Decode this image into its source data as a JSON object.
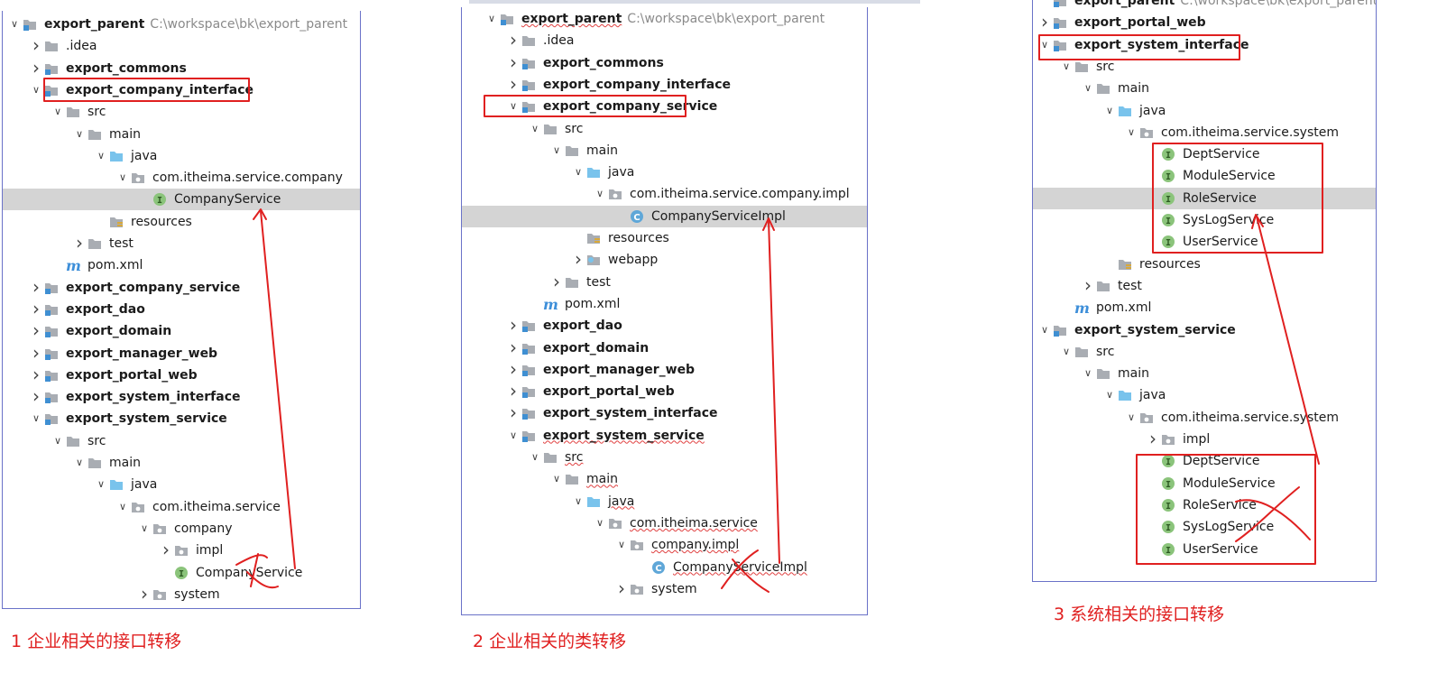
{
  "panels": [
    {
      "id": "p1",
      "rows": [
        {
          "d": 0,
          "arrow": "down",
          "icon": "module-folder",
          "text": "export_parent",
          "bold": true,
          "extra": "C:\\workspace\\bk\\export_parent"
        },
        {
          "d": 1,
          "arrow": "right",
          "icon": "folder",
          "text": ".idea"
        },
        {
          "d": 1,
          "arrow": "right",
          "icon": "module-folder",
          "text": "export_commons",
          "bold": true
        },
        {
          "d": 1,
          "arrow": "down",
          "icon": "module-folder",
          "text": "export_company_interface",
          "bold": true
        },
        {
          "d": 2,
          "arrow": "down",
          "icon": "folder",
          "text": "src"
        },
        {
          "d": 3,
          "arrow": "down",
          "icon": "folder",
          "text": "main"
        },
        {
          "d": 4,
          "arrow": "down",
          "icon": "source-folder",
          "text": "java"
        },
        {
          "d": 5,
          "arrow": "down",
          "icon": "package",
          "text": "com.itheima.service.company"
        },
        {
          "d": 6,
          "arrow": "none",
          "icon": "interface",
          "text": "CompanyService",
          "selected": true
        },
        {
          "d": 4,
          "arrow": "none",
          "icon": "resources-folder",
          "text": "resources"
        },
        {
          "d": 3,
          "arrow": "right",
          "icon": "folder",
          "text": "test"
        },
        {
          "d": 2,
          "arrow": "none",
          "icon": "maven",
          "text": "pom.xml"
        },
        {
          "d": 1,
          "arrow": "right",
          "icon": "module-folder",
          "text": "export_company_service",
          "bold": true
        },
        {
          "d": 1,
          "arrow": "right",
          "icon": "module-folder",
          "text": "export_dao",
          "bold": true
        },
        {
          "d": 1,
          "arrow": "right",
          "icon": "module-folder",
          "text": "export_domain",
          "bold": true
        },
        {
          "d": 1,
          "arrow": "right",
          "icon": "module-folder",
          "text": "export_manager_web",
          "bold": true
        },
        {
          "d": 1,
          "arrow": "right",
          "icon": "module-folder",
          "text": "export_portal_web",
          "bold": true
        },
        {
          "d": 1,
          "arrow": "right",
          "icon": "module-folder",
          "text": "export_system_interface",
          "bold": true
        },
        {
          "d": 1,
          "arrow": "down",
          "icon": "module-folder",
          "text": "export_system_service",
          "bold": true
        },
        {
          "d": 2,
          "arrow": "down",
          "icon": "folder",
          "text": "src"
        },
        {
          "d": 3,
          "arrow": "down",
          "icon": "folder",
          "text": "main"
        },
        {
          "d": 4,
          "arrow": "down",
          "icon": "source-folder",
          "text": "java"
        },
        {
          "d": 5,
          "arrow": "down",
          "icon": "package",
          "text": "com.itheima.service"
        },
        {
          "d": 6,
          "arrow": "down",
          "icon": "package",
          "text": "company"
        },
        {
          "d": 7,
          "arrow": "right",
          "icon": "package",
          "text": "impl"
        },
        {
          "d": 7,
          "arrow": "none",
          "icon": "interface",
          "text": "CompanyService"
        },
        {
          "d": 6,
          "arrow": "right",
          "icon": "package",
          "text": "system"
        }
      ]
    },
    {
      "id": "p2",
      "rows": [
        {
          "d": 0,
          "arrow": "down",
          "icon": "module-folder",
          "text": "export_parent",
          "bold": true,
          "squig": true,
          "extra": "C:\\workspace\\bk\\export_parent"
        },
        {
          "d": 1,
          "arrow": "right",
          "icon": "folder",
          "text": ".idea"
        },
        {
          "d": 1,
          "arrow": "right",
          "icon": "module-folder",
          "text": "export_commons",
          "bold": true
        },
        {
          "d": 1,
          "arrow": "right",
          "icon": "module-folder",
          "text": "export_company_interface",
          "bold": true
        },
        {
          "d": 1,
          "arrow": "down",
          "icon": "module-folder",
          "text": "export_company_service",
          "bold": true
        },
        {
          "d": 2,
          "arrow": "down",
          "icon": "folder",
          "text": "src"
        },
        {
          "d": 3,
          "arrow": "down",
          "icon": "folder",
          "text": "main"
        },
        {
          "d": 4,
          "arrow": "down",
          "icon": "source-folder",
          "text": "java"
        },
        {
          "d": 5,
          "arrow": "down",
          "icon": "package",
          "text": "com.itheima.service.company.impl"
        },
        {
          "d": 6,
          "arrow": "none",
          "icon": "class",
          "text": "CompanyServiceImpl",
          "selected": true
        },
        {
          "d": 4,
          "arrow": "none",
          "icon": "resources-folder",
          "text": "resources"
        },
        {
          "d": 4,
          "arrow": "right",
          "icon": "web-folder",
          "text": "webapp"
        },
        {
          "d": 3,
          "arrow": "right",
          "icon": "folder",
          "text": "test"
        },
        {
          "d": 2,
          "arrow": "none",
          "icon": "maven",
          "text": "pom.xml"
        },
        {
          "d": 1,
          "arrow": "right",
          "icon": "module-folder",
          "text": "export_dao",
          "bold": true
        },
        {
          "d": 1,
          "arrow": "right",
          "icon": "module-folder",
          "text": "export_domain",
          "bold": true
        },
        {
          "d": 1,
          "arrow": "right",
          "icon": "module-folder",
          "text": "export_manager_web",
          "bold": true
        },
        {
          "d": 1,
          "arrow": "right",
          "icon": "module-folder",
          "text": "export_portal_web",
          "bold": true
        },
        {
          "d": 1,
          "arrow": "right",
          "icon": "module-folder",
          "text": "export_system_interface",
          "bold": true
        },
        {
          "d": 1,
          "arrow": "down",
          "icon": "module-folder",
          "text": "export_system_service",
          "bold": true,
          "squig": true
        },
        {
          "d": 2,
          "arrow": "down",
          "icon": "folder",
          "text": "src",
          "squig": true
        },
        {
          "d": 3,
          "arrow": "down",
          "icon": "folder",
          "text": "main",
          "squig": true
        },
        {
          "d": 4,
          "arrow": "down",
          "icon": "source-folder",
          "text": "java",
          "squig": true
        },
        {
          "d": 5,
          "arrow": "down",
          "icon": "package",
          "text": "com.itheima.service",
          "squig": true
        },
        {
          "d": 6,
          "arrow": "down",
          "icon": "package",
          "text": "company.impl",
          "squig": true
        },
        {
          "d": 7,
          "arrow": "none",
          "icon": "class",
          "text": "CompanyServiceImpl",
          "squig": true
        },
        {
          "d": 6,
          "arrow": "right",
          "icon": "package",
          "text": "system"
        }
      ]
    },
    {
      "id": "p3",
      "rows": [
        {
          "d": 0,
          "arrow": "none",
          "icon": "module-folder",
          "text": "export_parent",
          "bold": true,
          "extra": "C:\\workspace\\bk\\export_parent"
        },
        {
          "d": 0,
          "arrow": "right",
          "icon": "module-folder",
          "text": "export_portal_web",
          "bold": true
        },
        {
          "d": 0,
          "arrow": "down",
          "icon": "module-folder",
          "text": "export_system_interface",
          "bold": true
        },
        {
          "d": 1,
          "arrow": "down",
          "icon": "folder",
          "text": "src"
        },
        {
          "d": 2,
          "arrow": "down",
          "icon": "folder",
          "text": "main"
        },
        {
          "d": 3,
          "arrow": "down",
          "icon": "source-folder",
          "text": "java"
        },
        {
          "d": 4,
          "arrow": "down",
          "icon": "package",
          "text": "com.itheima.service.system"
        },
        {
          "d": 5,
          "arrow": "none",
          "icon": "interface",
          "text": "DeptService"
        },
        {
          "d": 5,
          "arrow": "none",
          "icon": "interface",
          "text": "ModuleService"
        },
        {
          "d": 5,
          "arrow": "none",
          "icon": "interface",
          "text": "RoleService",
          "selected": true
        },
        {
          "d": 5,
          "arrow": "none",
          "icon": "interface",
          "text": "SysLogService"
        },
        {
          "d": 5,
          "arrow": "none",
          "icon": "interface",
          "text": "UserService"
        },
        {
          "d": 3,
          "arrow": "none",
          "icon": "resources-folder",
          "text": "resources"
        },
        {
          "d": 2,
          "arrow": "right",
          "icon": "folder",
          "text": "test"
        },
        {
          "d": 1,
          "arrow": "none",
          "icon": "maven",
          "text": "pom.xml"
        },
        {
          "d": 0,
          "arrow": "down",
          "icon": "module-folder",
          "text": "export_system_service",
          "bold": true
        },
        {
          "d": 1,
          "arrow": "down",
          "icon": "folder",
          "text": "src"
        },
        {
          "d": 2,
          "arrow": "down",
          "icon": "folder",
          "text": "main"
        },
        {
          "d": 3,
          "arrow": "down",
          "icon": "source-folder",
          "text": "java"
        },
        {
          "d": 4,
          "arrow": "down",
          "icon": "package",
          "text": "com.itheima.service.system"
        },
        {
          "d": 5,
          "arrow": "right",
          "icon": "package",
          "text": "impl"
        },
        {
          "d": 5,
          "arrow": "none",
          "icon": "interface",
          "text": "DeptService"
        },
        {
          "d": 5,
          "arrow": "none",
          "icon": "interface",
          "text": "ModuleService"
        },
        {
          "d": 5,
          "arrow": "none",
          "icon": "interface",
          "text": "RoleService"
        },
        {
          "d": 5,
          "arrow": "none",
          "icon": "interface",
          "text": "SysLogService"
        },
        {
          "d": 5,
          "arrow": "none",
          "icon": "interface",
          "text": "UserService"
        }
      ]
    }
  ],
  "captions": {
    "c1": "1 企业相关的接口转移",
    "c2": "2  企业相关的类转移",
    "c3": "3 系统相关的接口转移"
  },
  "colors": {
    "annotation": "#e02020",
    "folder": "#a9adb3",
    "source_folder": "#79c3ec",
    "module_marker": "#3f8fd2",
    "interface_badge": "#8bc47b",
    "class_badge": "#5fa7d8",
    "maven": "#3e8fd9"
  }
}
